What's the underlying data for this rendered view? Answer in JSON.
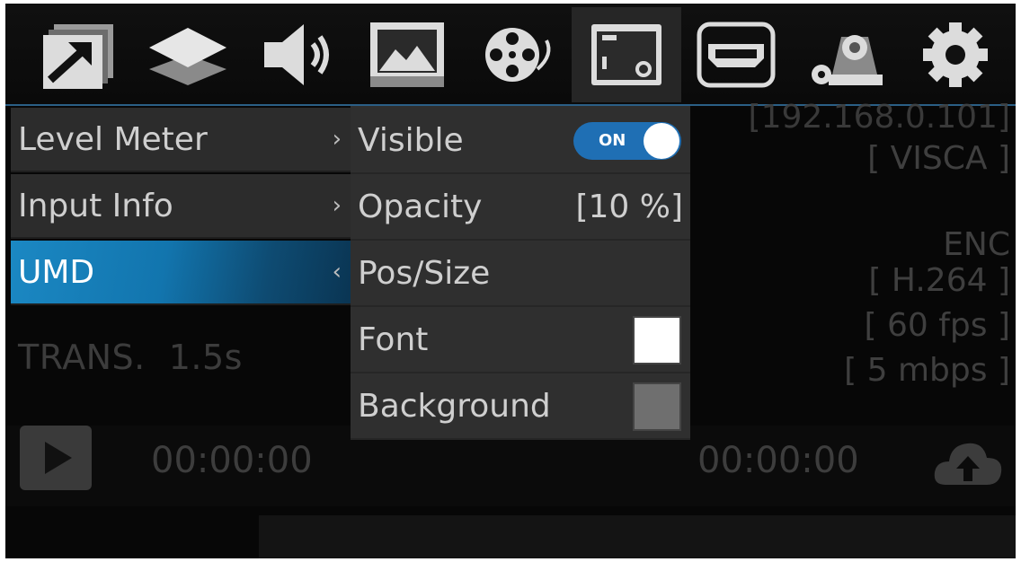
{
  "topbar": {
    "icons": [
      {
        "name": "external-link-icon",
        "active": false
      },
      {
        "name": "layers-icon",
        "active": false
      },
      {
        "name": "volume-icon",
        "active": false
      },
      {
        "name": "image-icon",
        "active": false
      },
      {
        "name": "film-reel-icon",
        "active": false
      },
      {
        "name": "overlay-settings-icon",
        "active": true
      },
      {
        "name": "hdmi-port-icon",
        "active": false
      },
      {
        "name": "ptz-camera-icon",
        "active": false
      },
      {
        "name": "gear-icon",
        "active": false
      }
    ],
    "accent_color": "#2b5f86"
  },
  "status": {
    "ip": "[192.168.0.101]",
    "protocol": "[ VISCA ]",
    "enc_label": "ENC",
    "codec": "[ H.264 ]",
    "fps": "[ 60 fps ]",
    "bitrate": "[ 5 mbps ]",
    "trans_label": "TRANS.",
    "trans_value": "1.5s"
  },
  "transport": {
    "timecode_left": "00:00:00",
    "timecode_right": "00:00:00"
  },
  "left_menu": {
    "items": [
      {
        "label": "Level Meter",
        "chevron": "›",
        "selected": false
      },
      {
        "label": "Input Info",
        "chevron": "›",
        "selected": false
      },
      {
        "label": "UMD",
        "chevron": "‹",
        "selected": true
      }
    ],
    "selected_color": "#1b88c3"
  },
  "submenu": {
    "visible_label": "Visible",
    "visible_toggle": "ON",
    "opacity_label": "Opacity",
    "opacity_value": "[10 %]",
    "pos_size_label": "Pos/Size",
    "font_label": "Font",
    "font_color": "#ffffff",
    "background_label": "Background",
    "background_color": "#6f6f6f"
  }
}
